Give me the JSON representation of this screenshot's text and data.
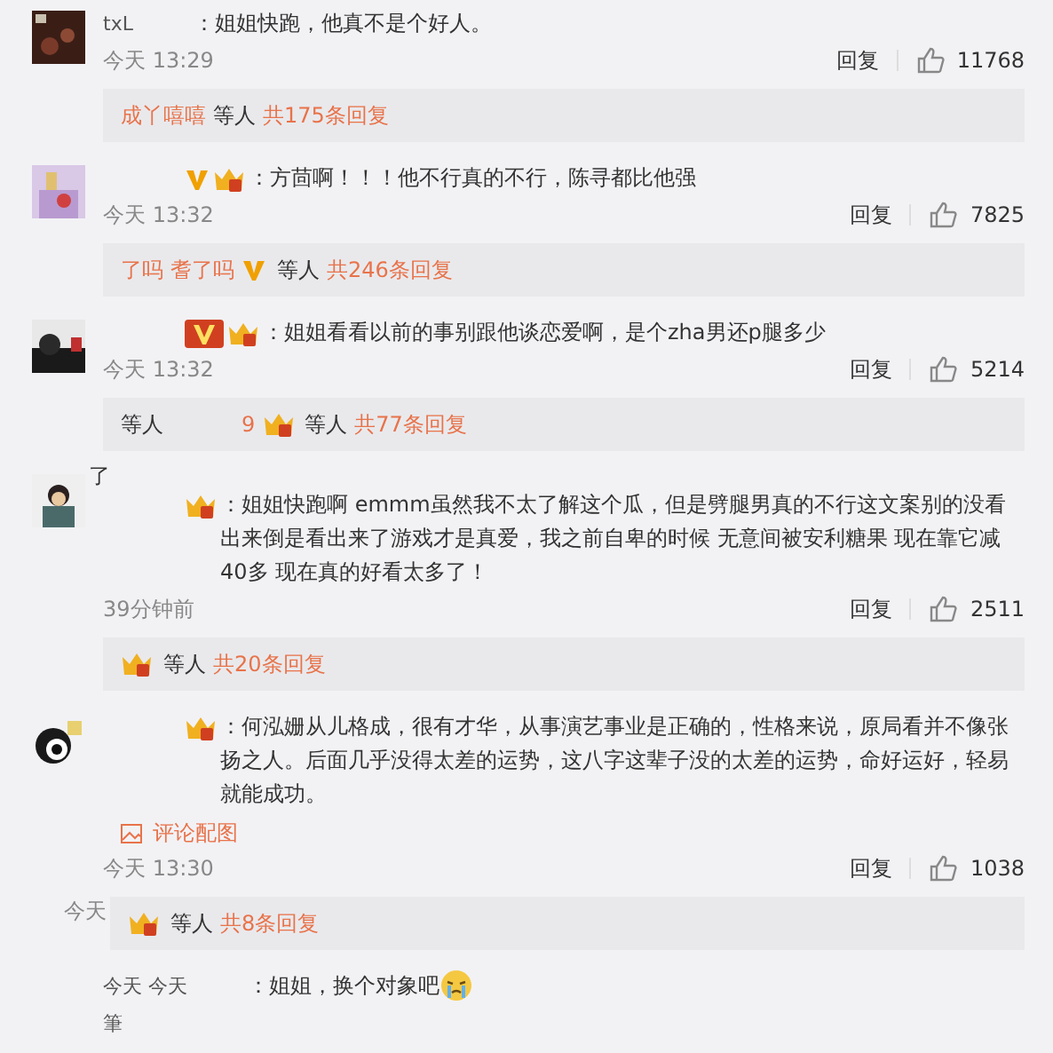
{
  "comments": [
    {
      "avatar": {
        "kind": "picture"
      },
      "name": "txL",
      "text": "：姐姐快跑，他真不是个好人。",
      "time": "今天 13:29",
      "reply_label": "回复",
      "likes": "11768",
      "replies": {
        "names": [
          "成丫嘻嘻"
        ],
        "etc": "等人",
        "count": "共175条回复"
      }
    },
    {
      "avatar": {
        "kind": "picture"
      },
      "badges": [
        {
          "kind": "v"
        },
        {
          "kind": "crown"
        }
      ],
      "text": "：方茴啊！！！他不行真的不行，陈寻都比他强",
      "time": "今天 13:32",
      "reply_label": "回复",
      "likes": "7825",
      "replies": {
        "names": [
          "了吗",
          "耆了吗"
        ],
        "badges": [
          {
            "kind": "v"
          }
        ],
        "etc": "等人",
        "count": "共246条回复"
      }
    },
    {
      "avatar": {
        "kind": "picture"
      },
      "badges": [
        {
          "kind": "v-box"
        },
        {
          "kind": "crown"
        }
      ],
      "text": "：姐姐看看以前的事别跟他谈恋爱啊，是个zha男还p腿多少",
      "time": "今天 13:32",
      "reply_label": "回复",
      "likes": "5214",
      "replies": {
        "prefix": "等人",
        "names": [
          "9"
        ],
        "badges": [
          {
            "kind": "crown"
          }
        ],
        "etc": "等人",
        "count": "共77条回复"
      }
    },
    {
      "avatar": {
        "kind": "picture"
      },
      "header": "了",
      "badges": [
        {
          "kind": "crown"
        }
      ],
      "text": "：姐姐快跑啊 emmm虽然我不太了解这个瓜，但是劈腿男真的不行这文案别的没看出来倒是看出来了游戏才是真爱，我之前自卑的时候 无意间被安利糖果 现在靠它减40多 现在真的好看太多了！",
      "time": "39分钟前",
      "reply_label": "回复",
      "likes": "2511",
      "replies": {
        "badges": [
          {
            "kind": "crown"
          }
        ],
        "etc": "等人",
        "count": "共20条回复"
      }
    },
    {
      "avatar": {
        "kind": "picture"
      },
      "badges": [
        {
          "kind": "crown"
        }
      ],
      "text": "：何泓姗从儿格成，很有才华，从事演艺事业是正确的，性格来说，原局看并不像张扬之人。后面几乎没得太差的运势，这八字这辈子没的太差的运势，命好运好，轻易就能成功。",
      "image_link": "评论配图",
      "time": "今天 13:30",
      "reply_label": "回复",
      "likes": "1038",
      "replies": {
        "stray": "今天",
        "badges": [
          {
            "kind": "crown"
          }
        ],
        "etc": "等人",
        "count": "共8条回复"
      }
    },
    {
      "name": "今天 今天",
      "text": "：姐姐，换个对象吧",
      "emoji": true
    },
    {
      "name": "筆"
    }
  ]
}
